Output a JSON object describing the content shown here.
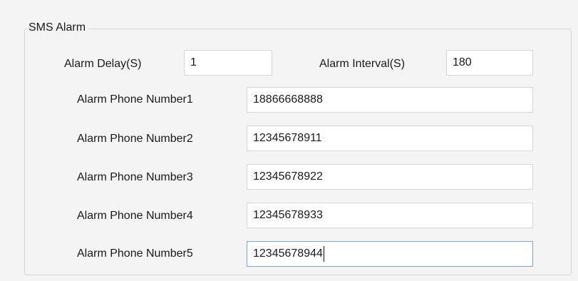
{
  "group": {
    "title": "SMS Alarm"
  },
  "alarm_delay": {
    "label": "Alarm Delay(S)",
    "value": "1"
  },
  "alarm_interval": {
    "label": "Alarm Interval(S)",
    "value": "180"
  },
  "phone_numbers": [
    {
      "label": "Alarm Phone Number1",
      "value": "18866668888"
    },
    {
      "label": "Alarm Phone Number2",
      "value": "12345678911"
    },
    {
      "label": "Alarm Phone Number3",
      "value": "12345678922"
    },
    {
      "label": "Alarm Phone Number4",
      "value": "12345678933"
    },
    {
      "label": "Alarm Phone Number5",
      "value": "12345678944"
    }
  ],
  "colors": {
    "background": "#f4f4f4",
    "field_border": "#d6d6d6",
    "focus_border": "#7aa7d8"
  }
}
